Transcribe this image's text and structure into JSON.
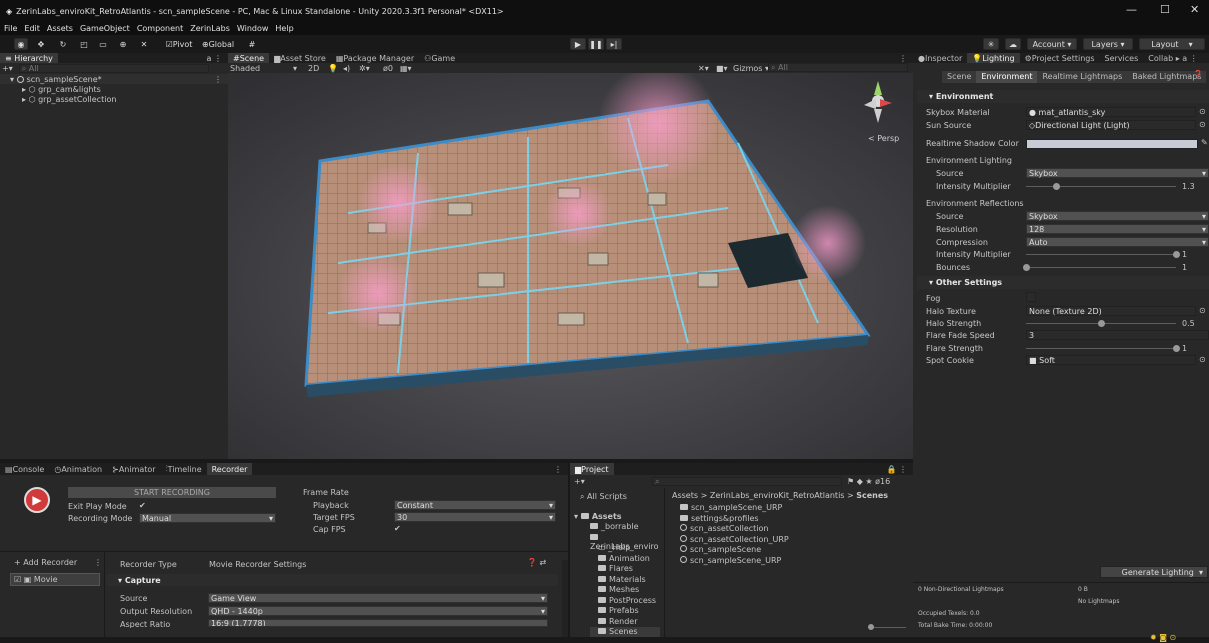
{
  "window": {
    "title": "ZerinLabs_enviroKit_RetroAtlantis - scn_sampleScene - PC, Mac & Linux Standalone - Unity 2020.3.3f1 Personal* <DX11>",
    "minimize": "—",
    "maximize": "☐",
    "close": "✕"
  },
  "menu": [
    "File",
    "Edit",
    "Assets",
    "GameObject",
    "Component",
    "ZerinLabs",
    "Window",
    "Help"
  ],
  "toolbar": {
    "pivot": "Pivot",
    "global": "Global",
    "account": "Account",
    "layers": "Layers",
    "layout": "Layout",
    "services": "Services",
    "collab": "Collab"
  },
  "hierarchy": {
    "tab": "Hierarchy",
    "search": "All",
    "items": [
      "scn_sampleScene*",
      "grp_cam&lights",
      "grp_assetCollection"
    ]
  },
  "scene": {
    "tabs": [
      "Scene",
      "Asset Store",
      "Package Manager",
      "Game"
    ],
    "shading": "Shaded",
    "mode2d": "2D",
    "gizmos": "Gizmos",
    "search": "All",
    "persp": "< Persp",
    "counter": "0"
  },
  "inspector": {
    "tabs": [
      "Inspector",
      "Lighting",
      "Project Settings"
    ],
    "subtabs": [
      "Scene",
      "Environment",
      "Realtime Lightmaps",
      "Baked Lightmaps"
    ],
    "environment": {
      "header": "Environment",
      "skybox_label": "Skybox Material",
      "skybox_value": "mat_atlantis_sky",
      "sun_label": "Sun Source",
      "sun_value": "Directional Light (Light)",
      "shadow_label": "Realtime Shadow Color",
      "env_lighting": "Environment Lighting",
      "source_label": "Source",
      "source_value": "Skybox",
      "intensity_label": "Intensity Multiplier",
      "intensity_value": "1.3",
      "env_reflections": "Environment Reflections",
      "refl_source_label": "Source",
      "refl_source_value": "Skybox",
      "resolution_label": "Resolution",
      "resolution_value": "128",
      "compression_label": "Compression",
      "compression_value": "Auto",
      "refl_intensity_label": "Intensity Multiplier",
      "refl_intensity_value": "1",
      "bounces_label": "Bounces",
      "bounces_value": "1"
    },
    "other": {
      "header": "Other Settings",
      "fog_label": "Fog",
      "halo_texture_label": "Halo Texture",
      "halo_texture_value": "None (Texture 2D)",
      "halo_strength_label": "Halo Strength",
      "halo_strength_value": "0.5",
      "flare_fade_label": "Flare Fade Speed",
      "flare_fade_value": "3",
      "flare_strength_label": "Flare Strength",
      "flare_strength_value": "1",
      "spot_cookie_label": "Spot Cookie",
      "spot_cookie_value": "Soft"
    },
    "generate": "Generate Lighting",
    "stats": {
      "non_directional": "0 Non-Directional Lightmaps",
      "size": "0 B",
      "no_lightmaps": "No Lightmaps",
      "occupied": "Occupied Texels: 0.0",
      "bake_time": "Total Bake Time: 0:00:00"
    }
  },
  "bottom_tabs": [
    "Console",
    "Animation",
    "Animator",
    "Timeline",
    "Recorder"
  ],
  "recorder": {
    "start": "START RECORDING",
    "exit_play_label": "Exit Play Mode",
    "recording_mode_label": "Recording Mode",
    "recording_mode_value": "Manual",
    "frame_rate": "Frame Rate",
    "playback_label": "Playback",
    "playback_value": "Constant",
    "target_fps_label": "Target FPS",
    "target_fps_value": "30",
    "cap_fps_label": "Cap FPS",
    "add_recorder": "+ Add Recorder",
    "movie": "Movie",
    "recorder_type_label": "Recorder Type",
    "recorder_type_value": "Movie Recorder Settings",
    "capture": "Capture",
    "source_label": "Source",
    "source_value": "Game View",
    "output_res_label": "Output Resolution",
    "output_res_value": "QHD - 1440p",
    "aspect_label": "Aspect Ratio",
    "aspect_value": "16:9 (1.7778)"
  },
  "project": {
    "tab": "Project",
    "count": "16",
    "favorites": [
      "All Scripts"
    ],
    "breadcrumb": [
      "Assets",
      "ZerinLabs_enviroKit_RetroAtlantis",
      "Scenes"
    ],
    "tree_root": "Assets",
    "tree": [
      "_borrable",
      "ZerinLabs_enviro",
      "_Help",
      "Animation",
      "Flares",
      "Materials",
      "Meshes",
      "PostProcess",
      "Prefabs",
      "Render",
      "Scenes"
    ],
    "files": [
      "scn_sampleScene_URP",
      "settings&profiles",
      "scn_assetCollection",
      "scn_assetCollection_URP",
      "scn_sampleScene",
      "scn_sampleScene_URP"
    ]
  }
}
